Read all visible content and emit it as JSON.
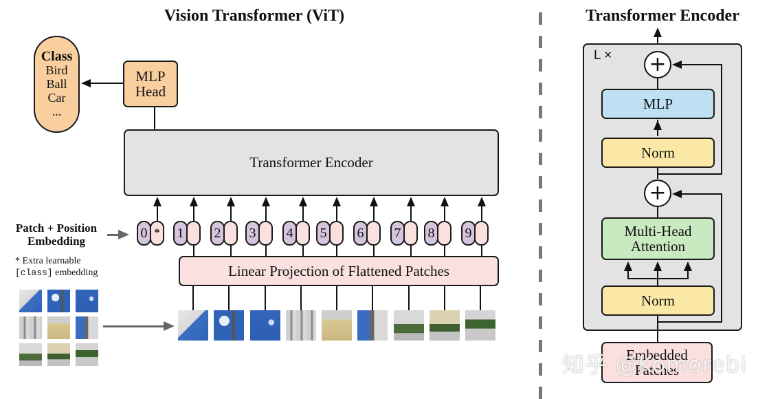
{
  "vit": {
    "title": "Vision Transformer (ViT)",
    "class_box": {
      "heading": "Class",
      "items": [
        "Bird",
        "Ball",
        "Car",
        "..."
      ]
    },
    "mlp_head": {
      "line1": "MLP",
      "line2": "Head"
    },
    "encoder_label": "Transformer Encoder",
    "embedding_label": {
      "line1": "Patch + Position",
      "line2": "Embedding"
    },
    "note": {
      "line1": "* Extra learnable",
      "code": "[class]",
      "line2_rest": " embedding"
    },
    "tokens": [
      {
        "pos": "0",
        "patch": "*"
      },
      {
        "pos": "1",
        "patch": ""
      },
      {
        "pos": "2",
        "patch": ""
      },
      {
        "pos": "3",
        "patch": ""
      },
      {
        "pos": "4",
        "patch": ""
      },
      {
        "pos": "5",
        "patch": ""
      },
      {
        "pos": "6",
        "patch": ""
      },
      {
        "pos": "7",
        "patch": ""
      },
      {
        "pos": "8",
        "patch": ""
      },
      {
        "pos": "9",
        "patch": ""
      }
    ],
    "projection_label": "Linear Projection of Flattened Patches",
    "patches": [
      "sky-dome",
      "sky-cloud-spire",
      "sky-spire",
      "facade-gray",
      "facade-yellow",
      "spire-facade",
      "garden-left",
      "garden-mid",
      "garden-right"
    ]
  },
  "encoder_detail": {
    "title": "Transformer Encoder",
    "repeat_label": "L ×",
    "plus_symbol": "+",
    "mlp_label": "MLP",
    "norm_label": "Norm",
    "mha_line1": "Multi-Head",
    "mha_line2": "Attention",
    "embedded_line1": "Embedded",
    "embedded_line2": "Patches"
  },
  "watermark": "知乎 @Komorebi",
  "colors": {
    "orange": "#f9cfa0",
    "gray_box": "#e3e3e3",
    "pink": "#fbe0e0",
    "purple": "#d5c5dd",
    "blue": "#bfe0f3",
    "yellow": "#fbe7a6",
    "green": "#c9e9c0"
  }
}
